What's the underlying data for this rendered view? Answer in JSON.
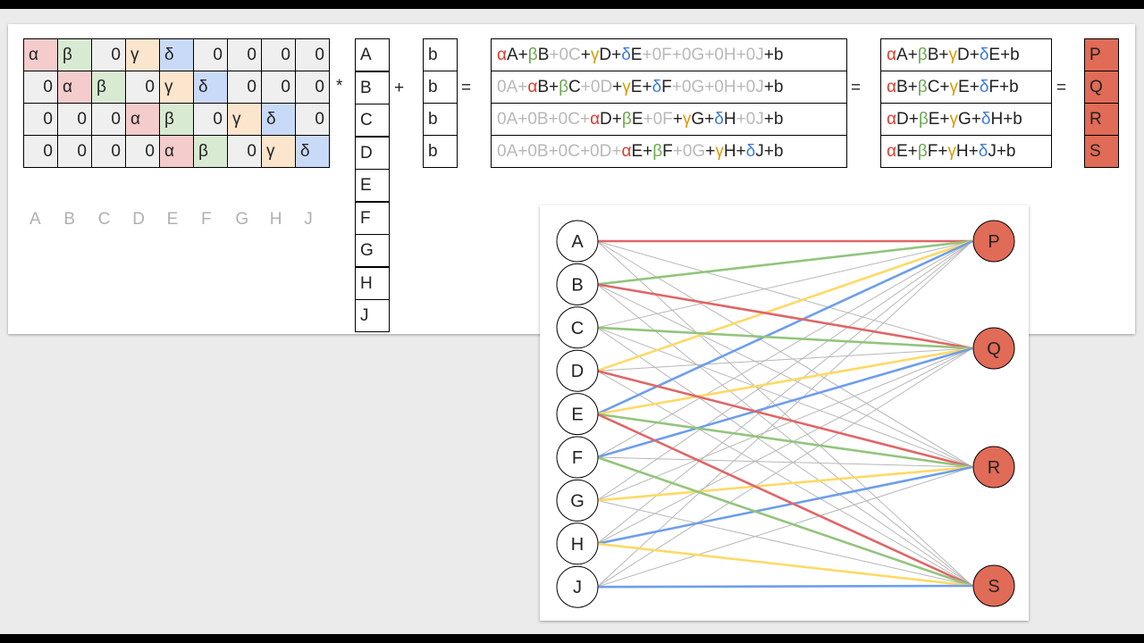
{
  "colors": {
    "alpha": "#f4cccc",
    "beta": "#d9ead3",
    "gamma": "#fce5cd",
    "delta": "#c9daf8",
    "zero": "#efefef",
    "output": "#e06b57",
    "edge_alpha": "#e06666",
    "edge_beta": "#93c47d",
    "edge_gamma": "#ffd966",
    "edge_delta": "#6d9eeb",
    "edge_zero": "#b7b7b7"
  },
  "matrix": {
    "rows": [
      [
        {
          "t": "α",
          "k": "alpha"
        },
        {
          "t": "β",
          "k": "beta"
        },
        {
          "t": "0",
          "k": "zero"
        },
        {
          "t": "γ",
          "k": "gamma"
        },
        {
          "t": "δ",
          "k": "delta"
        },
        {
          "t": "0",
          "k": "zero"
        },
        {
          "t": "0",
          "k": "zero"
        },
        {
          "t": "0",
          "k": "zero"
        },
        {
          "t": "0",
          "k": "zero"
        }
      ],
      [
        {
          "t": "0",
          "k": "zero"
        },
        {
          "t": "α",
          "k": "alpha"
        },
        {
          "t": "β",
          "k": "beta"
        },
        {
          "t": "0",
          "k": "zero"
        },
        {
          "t": "γ",
          "k": "gamma"
        },
        {
          "t": "δ",
          "k": "delta"
        },
        {
          "t": "0",
          "k": "zero"
        },
        {
          "t": "0",
          "k": "zero"
        },
        {
          "t": "0",
          "k": "zero"
        }
      ],
      [
        {
          "t": "0",
          "k": "zero"
        },
        {
          "t": "0",
          "k": "zero"
        },
        {
          "t": "0",
          "k": "zero"
        },
        {
          "t": "α",
          "k": "alpha"
        },
        {
          "t": "β",
          "k": "beta"
        },
        {
          "t": "0",
          "k": "zero"
        },
        {
          "t": "γ",
          "k": "gamma"
        },
        {
          "t": "δ",
          "k": "delta"
        },
        {
          "t": "0",
          "k": "zero"
        }
      ],
      [
        {
          "t": "0",
          "k": "zero"
        },
        {
          "t": "0",
          "k": "zero"
        },
        {
          "t": "0",
          "k": "zero"
        },
        {
          "t": "0",
          "k": "zero"
        },
        {
          "t": "α",
          "k": "alpha"
        },
        {
          "t": "β",
          "k": "beta"
        },
        {
          "t": "0",
          "k": "zero"
        },
        {
          "t": "γ",
          "k": "gamma"
        },
        {
          "t": "δ",
          "k": "delta"
        }
      ]
    ],
    "column_labels": [
      "A",
      "B",
      "C",
      "D",
      "E",
      "F",
      "G",
      "H",
      "J"
    ]
  },
  "operators": {
    "multiply": "*",
    "plus": "+",
    "equals_1": "=",
    "equals_2": "=",
    "equals_3": "="
  },
  "input_vector": [
    "A",
    "B",
    "C",
    "D",
    "E",
    "F",
    "G",
    "H",
    "J"
  ],
  "bias_vector": [
    "b",
    "b",
    "b",
    "b"
  ],
  "expanded_equations": [
    [
      {
        "t": "α",
        "c": "ta"
      },
      {
        "t": "A+",
        "c": "tv"
      },
      {
        "t": "β",
        "c": "tb"
      },
      {
        "t": "B",
        "c": "tv"
      },
      {
        "t": "+0C",
        "c": "tz"
      },
      {
        "t": "+",
        "c": "tv"
      },
      {
        "t": "γ",
        "c": "tg"
      },
      {
        "t": "D+",
        "c": "tv"
      },
      {
        "t": "δ",
        "c": "td"
      },
      {
        "t": "E",
        "c": "tv"
      },
      {
        "t": "+0F+0G+0H+0J",
        "c": "tz"
      },
      {
        "t": "+b",
        "c": "tv"
      }
    ],
    [
      {
        "t": "0A+",
        "c": "tz"
      },
      {
        "t": "α",
        "c": "ta"
      },
      {
        "t": "B+",
        "c": "tv"
      },
      {
        "t": "β",
        "c": "tb"
      },
      {
        "t": "C",
        "c": "tv"
      },
      {
        "t": "+0D",
        "c": "tz"
      },
      {
        "t": "+",
        "c": "tv"
      },
      {
        "t": "γ",
        "c": "tg"
      },
      {
        "t": "E+",
        "c": "tv"
      },
      {
        "t": "δ",
        "c": "td"
      },
      {
        "t": "F",
        "c": "tv"
      },
      {
        "t": "+0G+0H+0J",
        "c": "tz"
      },
      {
        "t": "+b",
        "c": "tv"
      }
    ],
    [
      {
        "t": "0A+0B+0C+",
        "c": "tz"
      },
      {
        "t": "α",
        "c": "ta"
      },
      {
        "t": "D+",
        "c": "tv"
      },
      {
        "t": "β",
        "c": "tb"
      },
      {
        "t": "E",
        "c": "tv"
      },
      {
        "t": "+0F",
        "c": "tz"
      },
      {
        "t": "+",
        "c": "tv"
      },
      {
        "t": "γ",
        "c": "tg"
      },
      {
        "t": "G+",
        "c": "tv"
      },
      {
        "t": "δ",
        "c": "td"
      },
      {
        "t": "H",
        "c": "tv"
      },
      {
        "t": "+0J",
        "c": "tz"
      },
      {
        "t": "+b",
        "c": "tv"
      }
    ],
    [
      {
        "t": "0A+0B+0C+0D+",
        "c": "tz"
      },
      {
        "t": "α",
        "c": "ta"
      },
      {
        "t": "E+",
        "c": "tv"
      },
      {
        "t": "β",
        "c": "tb"
      },
      {
        "t": "F",
        "c": "tv"
      },
      {
        "t": "+0G",
        "c": "tz"
      },
      {
        "t": "+",
        "c": "tv"
      },
      {
        "t": "γ",
        "c": "tg"
      },
      {
        "t": "H+",
        "c": "tv"
      },
      {
        "t": "δ",
        "c": "td"
      },
      {
        "t": "J+b",
        "c": "tv"
      }
    ]
  ],
  "simplified_equations": [
    [
      {
        "t": "α",
        "c": "ta"
      },
      {
        "t": "A+",
        "c": "tv"
      },
      {
        "t": "β",
        "c": "tb"
      },
      {
        "t": "B+",
        "c": "tv"
      },
      {
        "t": "γ",
        "c": "tg"
      },
      {
        "t": "D+",
        "c": "tv"
      },
      {
        "t": "δ",
        "c": "td"
      },
      {
        "t": "E+b",
        "c": "tv"
      }
    ],
    [
      {
        "t": "α",
        "c": "ta"
      },
      {
        "t": "B+",
        "c": "tv"
      },
      {
        "t": "β",
        "c": "tb"
      },
      {
        "t": "C+",
        "c": "tv"
      },
      {
        "t": "γ",
        "c": "tg"
      },
      {
        "t": "E+",
        "c": "tv"
      },
      {
        "t": "δ",
        "c": "td"
      },
      {
        "t": "F+b",
        "c": "tv"
      }
    ],
    [
      {
        "t": "α",
        "c": "ta"
      },
      {
        "t": "D+",
        "c": "tv"
      },
      {
        "t": "β",
        "c": "tb"
      },
      {
        "t": "E+",
        "c": "tv"
      },
      {
        "t": "γ",
        "c": "tg"
      },
      {
        "t": "G+",
        "c": "tv"
      },
      {
        "t": "δ",
        "c": "td"
      },
      {
        "t": "H+b",
        "c": "tv"
      }
    ],
    [
      {
        "t": "α",
        "c": "ta"
      },
      {
        "t": "E+",
        "c": "tv"
      },
      {
        "t": "β",
        "c": "tb"
      },
      {
        "t": "F+",
        "c": "tv"
      },
      {
        "t": "γ",
        "c": "tg"
      },
      {
        "t": "H+",
        "c": "tv"
      },
      {
        "t": "δ",
        "c": "td"
      },
      {
        "t": "J+b",
        "c": "tv"
      }
    ]
  ],
  "output_vector": [
    "P",
    "Q",
    "R",
    "S"
  ],
  "graph": {
    "input_nodes": [
      "A",
      "B",
      "C",
      "D",
      "E",
      "F",
      "G",
      "H",
      "J"
    ],
    "output_nodes": [
      "P",
      "Q",
      "R",
      "S"
    ],
    "weighted_edges": [
      {
        "from": "A",
        "to": "P",
        "w": "alpha"
      },
      {
        "from": "B",
        "to": "P",
        "w": "beta"
      },
      {
        "from": "D",
        "to": "P",
        "w": "gamma"
      },
      {
        "from": "E",
        "to": "P",
        "w": "delta"
      },
      {
        "from": "B",
        "to": "Q",
        "w": "alpha"
      },
      {
        "from": "C",
        "to": "Q",
        "w": "beta"
      },
      {
        "from": "E",
        "to": "Q",
        "w": "gamma"
      },
      {
        "from": "F",
        "to": "Q",
        "w": "delta"
      },
      {
        "from": "D",
        "to": "R",
        "w": "alpha"
      },
      {
        "from": "E",
        "to": "R",
        "w": "beta"
      },
      {
        "from": "G",
        "to": "R",
        "w": "gamma"
      },
      {
        "from": "H",
        "to": "R",
        "w": "delta"
      },
      {
        "from": "E",
        "to": "S",
        "w": "alpha"
      },
      {
        "from": "F",
        "to": "S",
        "w": "beta"
      },
      {
        "from": "H",
        "to": "S",
        "w": "gamma"
      },
      {
        "from": "J",
        "to": "S",
        "w": "delta"
      }
    ]
  }
}
